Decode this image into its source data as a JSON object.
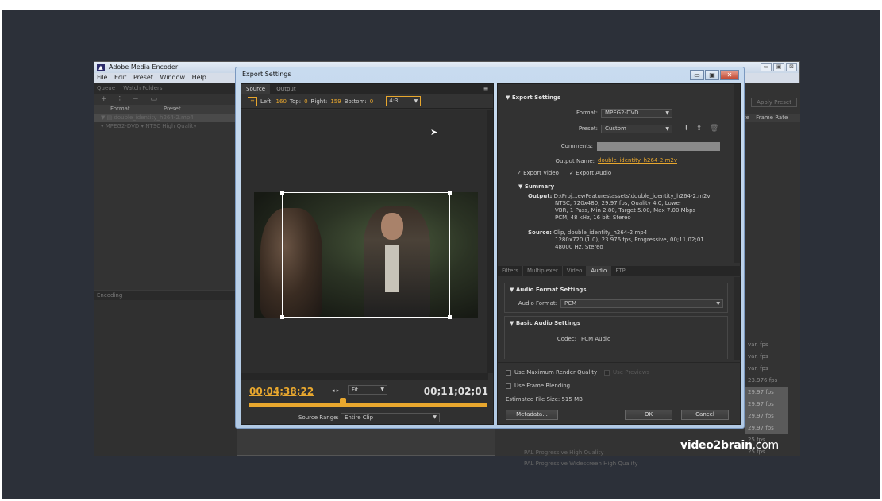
{
  "app": {
    "title": "Adobe Media Encoder",
    "menu": [
      "File",
      "Edit",
      "Preset",
      "Window",
      "Help"
    ],
    "window_buttons": [
      "▭",
      "▣",
      "⊠"
    ],
    "queue": {
      "tabs": [
        "Queue",
        "Watch Folders"
      ],
      "toolbar": "+ ⁝ − ▭",
      "columns": [
        "Format",
        "Preset"
      ],
      "rows": [
        "▼ ▤ double_identity_h264-2.mp4",
        "▾ MPEG2-DVD ▾ NTSC High Quality"
      ]
    },
    "encoding_tab": "Encoding",
    "preset_browser": {
      "apply_preset": "Apply Preset",
      "columns": [
        "ize",
        "Frame Rate"
      ],
      "frame_rates": [
        "var. fps",
        "var. fps",
        "var. fps",
        "23.976 fps",
        "29.97 fps",
        "29.97 fps",
        "29.97 fps",
        "29.97 fps",
        "25 fps",
        "25 fps"
      ],
      "names": [
        "PAL Progressive High Quality",
        "PAL Progressive Widescreen High Quality"
      ]
    },
    "watermark_brand": "video2brain",
    "watermark_suffix": ".com"
  },
  "dialog": {
    "title": "Export Settings",
    "buttons": [
      "▭",
      "▣",
      "✕"
    ],
    "source_tabs": [
      "Source",
      "Output"
    ],
    "crop": {
      "left_label": "Left:",
      "left": "160",
      "top_label": "Top:",
      "top": "0",
      "right_label": "Right:",
      "right": "159",
      "bottom_label": "Bottom:",
      "bottom": "0",
      "aspect": "4:3"
    },
    "timecode_current": "00;04;38;22",
    "zoom": "Fit",
    "timecode_duration": "00;11;02;01",
    "source_range_label": "Source Range:",
    "source_range": "Entire Clip",
    "export_settings": {
      "header": "Export Settings",
      "format_label": "Format:",
      "format": "MPEG2-DVD",
      "preset_label": "Preset:",
      "preset": "Custom",
      "comments_label": "Comments:",
      "output_name_label": "Output Name:",
      "output_name": "double_identity_h264-2.m2v",
      "export_video": "Export Video",
      "export_audio": "Export Audio"
    },
    "summary": {
      "header": "Summary",
      "output_label": "Output:",
      "output_lines": [
        "D:\\Proj...ewFeatures\\assets\\double_identity_h264-2.m2v",
        "NTSC, 720x480, 29.97 fps, Quality 4.0, Lower",
        "VBR, 1 Pass, Min 2.80, Target 5.00, Max 7.00 Mbps",
        "PCM, 48 kHz, 16 bit, Stereo"
      ],
      "source_label": "Source:",
      "source_lines": [
        "Clip, double_identity_h264-2.mp4",
        "1280x720 (1.0), 23.976 fps, Progressive, 00;11;02;01",
        "48000 Hz, Stereo"
      ]
    },
    "tabs": [
      "Filters",
      "Multiplexer",
      "Video",
      "Audio",
      "FTP"
    ],
    "active_tab": "Audio",
    "audio": {
      "format_header": "Audio Format Settings",
      "format_label": "Audio Format:",
      "format": "PCM",
      "basic_header": "Basic Audio Settings",
      "codec_label": "Codec:",
      "codec": "PCM Audio"
    },
    "options": {
      "max_render": "Use Maximum Render Quality",
      "use_previews": "Use Previews",
      "frame_blending": "Use Frame Blending",
      "file_size": "Estimated File Size: 515 MB"
    },
    "metadata_button": "Metadata...",
    "ok_button": "OK",
    "cancel_button": "Cancel"
  },
  "colors": {
    "accent": "#e8a72e",
    "panel": "#323232",
    "backdrop": "#2c3039"
  }
}
